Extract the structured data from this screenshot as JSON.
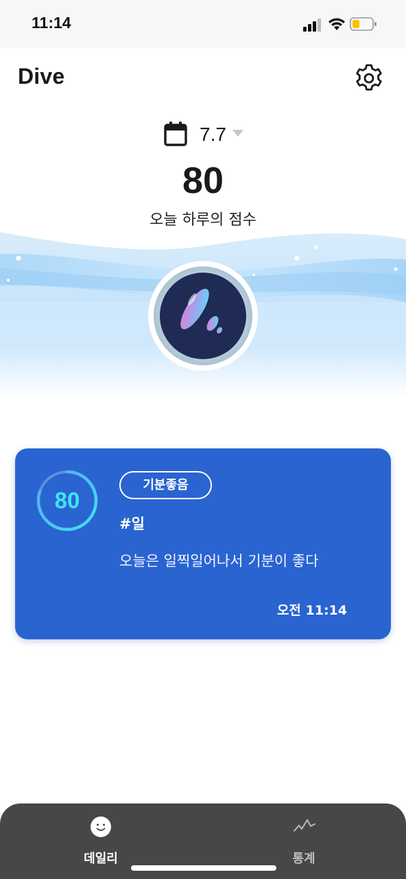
{
  "status_bar": {
    "time": "11:14",
    "icons": [
      "cellular-signal-icon",
      "wifi-icon",
      "battery-icon"
    ],
    "battery_color": "#f5c400"
  },
  "header": {
    "title": "Dive",
    "settings_icon": "gear-icon"
  },
  "date_picker": {
    "value": "7.7",
    "icon": "calendar-icon"
  },
  "summary": {
    "score": "80",
    "caption": "오늘 하루의 점수"
  },
  "entry": {
    "score": "80",
    "score_ring_fraction": 0.8,
    "mood_tag": "기분좋음",
    "hashtag": "#일",
    "note": "오늘은 일찍일어나서 기분이 좋다",
    "time": "오전 11:14"
  },
  "tabs": [
    {
      "label": "데일리",
      "icon": "smile-face-icon",
      "active": true
    },
    {
      "label": "통계",
      "icon": "line-chart-icon",
      "active": false
    }
  ],
  "colors": {
    "card": "#2a64d1",
    "score_accent": "#3fe3f4",
    "tab_bar": "#474747",
    "orb": "#1f2b55"
  }
}
